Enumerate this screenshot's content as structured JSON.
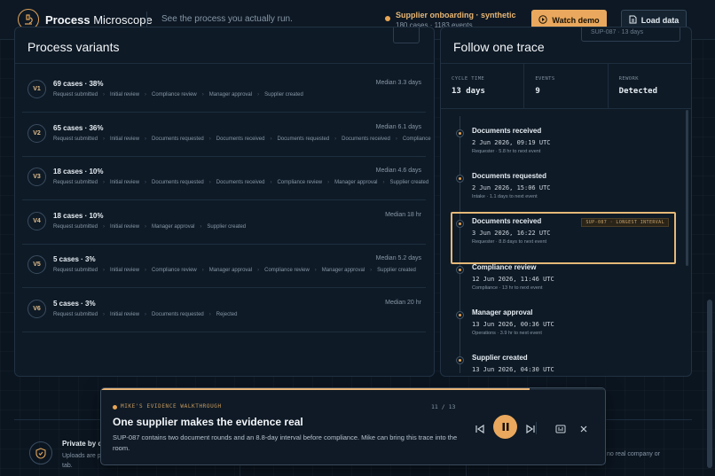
{
  "header": {
    "brand_bold": "Process",
    "brand_light": "Microscope",
    "tagline": "See the process you actually run.",
    "dataset_title": "Supplier onboarding · synthetic",
    "dataset_sub": "180 cases · 1183 events",
    "watch_demo": "Watch demo",
    "load_data": "Load data"
  },
  "variants_panel": {
    "title": "Process variants",
    "variants": [
      {
        "id": "V1",
        "title": "69 cases · 38%",
        "median": "Median 3.3 days",
        "steps": [
          "Request submitted",
          "Initial review",
          "Compliance review",
          "Manager approval",
          "Supplier created"
        ]
      },
      {
        "id": "V2",
        "title": "65 cases · 36%",
        "median": "Median 6.1 days",
        "steps": [
          "Request submitted",
          "Initial review",
          "Documents requested",
          "Documents received",
          "Documents requested",
          "Documents received",
          "Compliance"
        ]
      },
      {
        "id": "V3",
        "title": "18 cases · 10%",
        "median": "Median 4.6 days",
        "steps": [
          "Request submitted",
          "Initial review",
          "Documents requested",
          "Documents received",
          "Compliance review",
          "Manager approval",
          "Supplier created"
        ]
      },
      {
        "id": "V4",
        "title": "18 cases · 10%",
        "median": "Median 18 hr",
        "steps": [
          "Request submitted",
          "Initial review",
          "Manager approval",
          "Supplier created"
        ]
      },
      {
        "id": "V5",
        "title": "5 cases · 3%",
        "median": "Median 5.2 days",
        "steps": [
          "Request submitted",
          "Initial review",
          "Compliance review",
          "Manager approval",
          "Compliance review",
          "Manager approval",
          "Supplier created"
        ]
      },
      {
        "id": "V6",
        "title": "5 cases · 3%",
        "median": "Median 20 hr",
        "steps": [
          "Request submitted",
          "Initial review",
          "Documents requested",
          "Rejected"
        ]
      }
    ]
  },
  "trace_panel": {
    "title": "Follow one trace",
    "date_stub": "SUP-087 · 13 days",
    "metrics": [
      {
        "label": "CYCLE TIME",
        "value": "13 days"
      },
      {
        "label": "EVENTS",
        "value": "9"
      },
      {
        "label": "REWORK",
        "value": "Detected"
      }
    ],
    "events": [
      {
        "title": "Documents received",
        "time": "2 Jun 2026, 09:19 UTC",
        "note": "Requester · 5.8 hr to next event"
      },
      {
        "title": "Documents requested",
        "time": "2 Jun 2026, 15:06 UTC",
        "note": "Intake · 1.1 days to next event"
      },
      {
        "title": "Documents received",
        "time": "3 Jun 2026, 16:22 UTC",
        "note": "Requester · 8.8 days to next event",
        "tag": "SUP-087 · LONGEST INTERVAL"
      },
      {
        "title": "Compliance review",
        "time": "12 Jun 2026, 11:46 UTC",
        "note": "Compliance · 13 hr to next event"
      },
      {
        "title": "Manager approval",
        "time": "13 Jun 2026, 00:36 UTC",
        "note": "Operations · 3.9 hr to next event"
      },
      {
        "title": "Supplier created",
        "time": "13 Jun 2026, 04:30 UTC",
        "note": ""
      }
    ]
  },
  "footer": {
    "title": "Private by d",
    "text_line1": "Uploads are p",
    "text_line2": "tab.",
    "text_right": "no real company or"
  },
  "walkthrough": {
    "kicker": "MIKE'S EVIDENCE WALKTHROUGH",
    "count": "11 / 13",
    "progress": 0.85,
    "title": "One supplier makes the evidence real",
    "body": "SUP-087 contains two document rounds and an 8.8-day interval before compliance. Mike can bring this trace into the room."
  },
  "colors": {
    "accent": "#e9a85d",
    "background": "#0b1520",
    "panel": "#0e1a26"
  }
}
